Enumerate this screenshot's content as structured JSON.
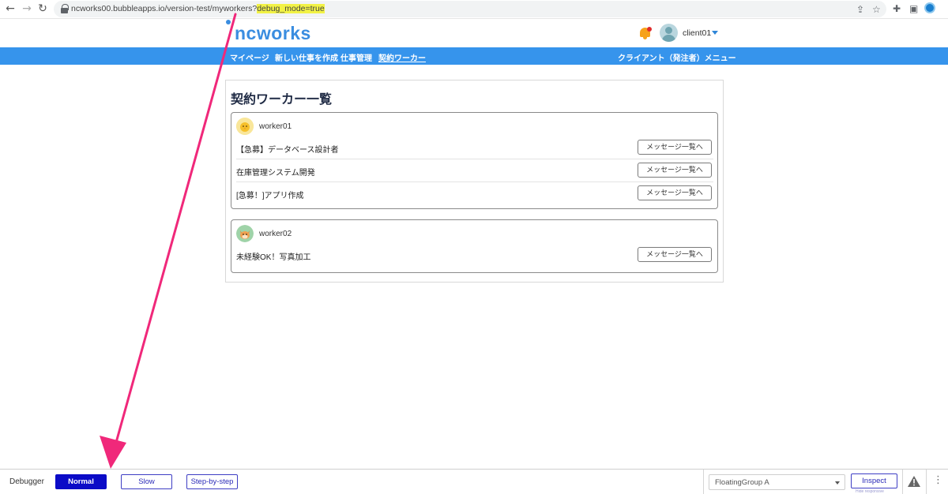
{
  "browser": {
    "back_icon": "arrow-left-icon",
    "forward_icon": "arrow-right-icon",
    "reload_icon": "reload-icon",
    "url_prefix": "ncworks00.bubbleapps.io/version-test/myworkers?",
    "url_highlight": "debug_mode=true"
  },
  "header": {
    "logo": "ncworks",
    "username": "client01"
  },
  "nav": {
    "items": [
      {
        "label": "マイページ"
      },
      {
        "label": "新しい仕事を作成"
      },
      {
        "label": "仕事管理"
      },
      {
        "label": "契約ワーカー"
      }
    ],
    "right_label": "クライアント（発注者）メニュー"
  },
  "page": {
    "title": "契約ワーカー一覧"
  },
  "workers": [
    {
      "name": "worker01",
      "jobs": [
        {
          "title": "【急募】データベース設計者",
          "button": "メッセージ一覧へ"
        },
        {
          "title": "在庫管理システム開発",
          "button": "メッセージ一覧へ"
        },
        {
          "title": "[急募！]アプリ作成",
          "button": "メッセージ一覧へ"
        }
      ]
    },
    {
      "name": "worker02",
      "jobs": [
        {
          "title": "未経験OK！写真加工",
          "button": "メッセージ一覧へ"
        }
      ]
    }
  ],
  "annotation": {
    "arrow_color": "#f0287a"
  },
  "debugger": {
    "label": "Debugger",
    "modes": [
      {
        "label": "Normal",
        "active": true
      },
      {
        "label": "Slow",
        "active": false
      },
      {
        "label": "Step-by-step",
        "active": false
      }
    ],
    "element_select": "FloatingGroup A",
    "inspect_label": "Inspect",
    "inspect_hint": "Hide responsive"
  }
}
